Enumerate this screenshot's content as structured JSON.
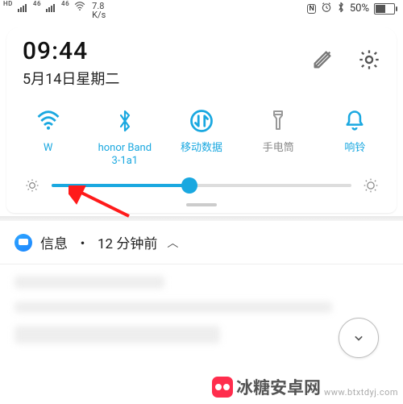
{
  "status_bar": {
    "signal1_label": "HD",
    "signal1_net": "46",
    "signal2_net": "46",
    "wifi_on": true,
    "net_speed_value": "7.8",
    "net_speed_unit": "K/s",
    "nfc": "N",
    "bt_on": true,
    "battery_text": "50%",
    "battery_pct": 50
  },
  "panel": {
    "time": "09:44",
    "date": "5月14日星期二"
  },
  "toggles": [
    {
      "name": "wifi",
      "label": "W",
      "active": true
    },
    {
      "name": "bluetooth",
      "label": "honor Band\n3-1a1",
      "active": true
    },
    {
      "name": "mobile-data",
      "label": "移动数据",
      "active": true
    },
    {
      "name": "flashlight",
      "label": "手电筒",
      "active": false
    },
    {
      "name": "ringer",
      "label": "响铃",
      "active": true
    }
  ],
  "brightness": {
    "value_pct": 46
  },
  "notification": {
    "app": "信息",
    "separator": "・",
    "time_ago": "12 分钟前"
  },
  "watermark": {
    "text": "冰糖安卓网",
    "sub": "www.btxtdyj.com"
  },
  "colors": {
    "accent": "#1aa8e0",
    "inactive": "#8a8a8a"
  }
}
